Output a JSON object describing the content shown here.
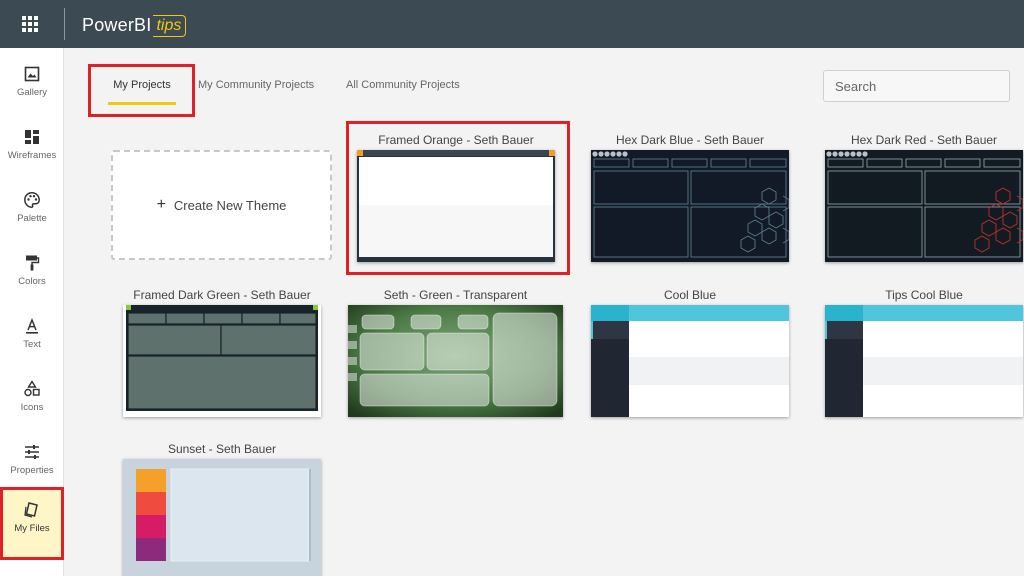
{
  "app": {
    "brand_main": "PowerBI",
    "brand_sub": "tips"
  },
  "sidebar": {
    "items": [
      {
        "label": "Gallery",
        "icon": "gallery-icon"
      },
      {
        "label": "Wireframes",
        "icon": "wireframes-icon"
      },
      {
        "label": "Palette",
        "icon": "palette-icon"
      },
      {
        "label": "Colors",
        "icon": "paint-roller-icon"
      },
      {
        "label": "Text",
        "icon": "text-icon"
      },
      {
        "label": "Icons",
        "icon": "shapes-icon"
      },
      {
        "label": "Properties",
        "icon": "sliders-icon"
      },
      {
        "label": "My Files",
        "icon": "files-icon",
        "active": true
      }
    ]
  },
  "tabs": [
    {
      "label": "My Projects",
      "active": true
    },
    {
      "label": "My Community Projects"
    },
    {
      "label": "All Community Projects"
    }
  ],
  "search": {
    "placeholder": "Search"
  },
  "create_card": {
    "label": "Create New Theme"
  },
  "themes": [
    {
      "title": "Framed Orange - Seth Bauer",
      "style": "framed-orange",
      "highlighted": true
    },
    {
      "title": "Hex Dark Blue - Seth Bauer",
      "style": "hex-dark-blue"
    },
    {
      "title": "Hex Dark Red - Seth Bauer",
      "style": "hex-dark-red"
    },
    {
      "title": "Framed Dark Green - Seth Bauer",
      "style": "framed-dark-green"
    },
    {
      "title": "Seth - Green - Transparent",
      "style": "green-transparent"
    },
    {
      "title": "Cool Blue",
      "style": "cool-blue"
    },
    {
      "title": "Tips Cool Blue",
      "style": "tips-cool-blue"
    },
    {
      "title": "Sunset - Seth Bauer",
      "style": "sunset"
    }
  ],
  "colors": {
    "topbar": "#3b4a53",
    "accent_yellow": "#f2c811",
    "highlight_red": "#e31e24",
    "hex_blue_line": "#5b7a8a",
    "hex_red_line": "#c0302e",
    "cool_blue": "#4fc6dc",
    "sunset_orange": "#f5a02b",
    "sunset_red": "#ef4b3f",
    "sunset_pink": "#d61c64",
    "sunset_purple": "#8e2a7c"
  }
}
